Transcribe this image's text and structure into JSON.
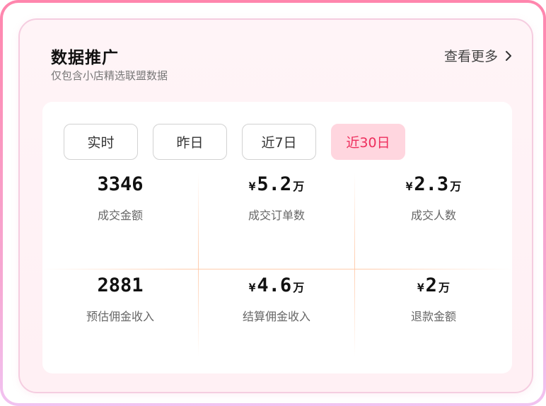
{
  "header": {
    "title": "数据推广",
    "subtitle": "仅包含小店精选联盟数据",
    "more_label": "查看更多"
  },
  "tabs": [
    {
      "label": "实时",
      "active": false
    },
    {
      "label": "昨日",
      "active": false
    },
    {
      "label": "近7日",
      "active": false
    },
    {
      "label": "近30日",
      "active": true
    }
  ],
  "metrics": [
    {
      "prefix": "",
      "value": "3346",
      "unit": "",
      "label": "成交金额"
    },
    {
      "prefix": "¥",
      "value": "5.2",
      "unit": "万",
      "label": "成交订单数"
    },
    {
      "prefix": "¥",
      "value": "2.3",
      "unit": "万",
      "label": "成交人数"
    },
    {
      "prefix": "",
      "value": "2881",
      "unit": "",
      "label": "预估佣金收入"
    },
    {
      "prefix": "¥",
      "value": "4.6",
      "unit": "万",
      "label": "结算佣金收入"
    },
    {
      "prefix": "¥",
      "value": "2",
      "unit": "万",
      "label": "退款金额"
    }
  ],
  "colors": {
    "accent": "#ee2d5c",
    "active_tab_bg": "#ffd6df",
    "card_bg": "#fff2f6",
    "divider": "#ffc4a0"
  },
  "icons": {
    "more": "chevron-right-icon"
  }
}
